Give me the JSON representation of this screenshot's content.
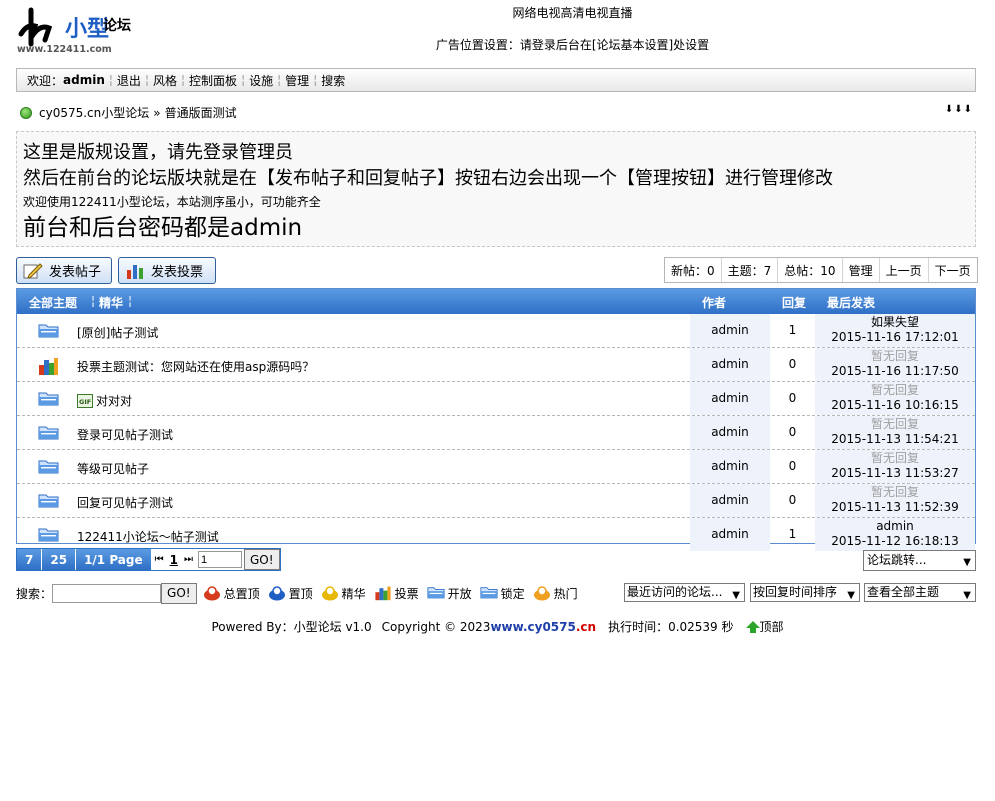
{
  "header": {
    "logo_big": "小型",
    "logo_small": "论坛",
    "logo_url": "www.122411.com",
    "ad_top": "网络电视高清电视直播",
    "ad_main": "广告位置设置：请登录后台在[论坛基本设置]处设置"
  },
  "nav": {
    "welcome": "欢迎：",
    "user": "admin",
    "items": [
      "退出",
      "风格",
      "控制面板",
      "设施",
      "管理",
      "搜索"
    ]
  },
  "breadcrumb": {
    "site": "cy0575.cn小型论坛",
    "separator": "»",
    "board": "普通版面测试",
    "arrows": "⬇⬇⬇"
  },
  "rules": {
    "line1": "这里是版规设置，请先登录管理员",
    "line2": "然后在前台的论坛版块就是在【发布帖子和回复帖子】按钮右边会出现一个【管理按钮】进行管理修改",
    "line3": "欢迎使用122411小型论坛，本站测序虽小，可功能齐全",
    "line4": "前台和后台密码都是admin"
  },
  "buttons": {
    "post": "发表帖子",
    "poll": "发表投票"
  },
  "stats": {
    "new_posts": "新帖：0",
    "topics": "主题：7",
    "total": "总帖：10",
    "manage": "管理",
    "prev": "上一页",
    "next": "下一页"
  },
  "table": {
    "col_all": "全部主题",
    "col_elite": "精华",
    "col_author": "作者",
    "col_replies": "回复",
    "col_last": "最后发表",
    "rows": [
      {
        "icon": "folder-icon",
        "title": "[原创]帖子测试",
        "author": "admin",
        "replies": "1",
        "last_user": "如果失望",
        "last_time": "2015-11-16 17:12:01",
        "gif": false,
        "no_reply": false
      },
      {
        "icon": "poll-icon",
        "title": "投票主题测试：您网站还在使用asp源码吗？",
        "author": "admin",
        "replies": "0",
        "last_user": "暂无回复",
        "last_time": "2015-11-16 11:17:50",
        "gif": false,
        "no_reply": true
      },
      {
        "icon": "folder-icon",
        "title": "对对对",
        "author": "admin",
        "replies": "0",
        "last_user": "暂无回复",
        "last_time": "2015-11-16 10:16:15",
        "gif": true,
        "no_reply": true
      },
      {
        "icon": "folder-icon",
        "title": "登录可见帖子测试",
        "author": "admin",
        "replies": "0",
        "last_user": "暂无回复",
        "last_time": "2015-11-13 11:54:21",
        "gif": false,
        "no_reply": true
      },
      {
        "icon": "folder-icon",
        "title": "等级可见帖子",
        "author": "admin",
        "replies": "0",
        "last_user": "暂无回复",
        "last_time": "2015-11-13 11:53:27",
        "gif": false,
        "no_reply": true
      },
      {
        "icon": "folder-icon",
        "title": "回复可见帖子测试",
        "author": "admin",
        "replies": "0",
        "last_user": "暂无回复",
        "last_time": "2015-11-13 11:52:39",
        "gif": false,
        "no_reply": true
      },
      {
        "icon": "folder-icon",
        "title": "122411小论坛～帖子测试",
        "author": "admin",
        "replies": "1",
        "last_user": "admin",
        "last_time": "2015-11-12 16:18:13",
        "gif": false,
        "no_reply": false
      }
    ]
  },
  "pager": {
    "per_topics": "7",
    "per_page": "25",
    "page_info": "1/1 Page",
    "first": "⏮",
    "current": "1",
    "last": "⏭",
    "input_value": "1",
    "go": "GO!"
  },
  "jump": {
    "label": "论坛跳转..."
  },
  "legend": {
    "search_label": "搜索：",
    "go": "GO!",
    "items": [
      {
        "icon": "global-top-icon",
        "label": "总置顶",
        "color": "#d63a1c"
      },
      {
        "icon": "top-icon",
        "label": "置顶",
        "color": "#1f5fc4"
      },
      {
        "icon": "elite-icon",
        "label": "精华",
        "color": "#e6b800"
      },
      {
        "icon": "poll-icon",
        "label": "投票",
        "color": "#c8261a"
      },
      {
        "icon": "open-icon",
        "label": "开放",
        "color": "#4a8be0"
      },
      {
        "icon": "lock-icon",
        "label": "锁定",
        "color": "#4a8be0"
      },
      {
        "icon": "hot-icon",
        "label": "热门",
        "color": "#f0a020"
      }
    ],
    "sel_recent": "最近访问的论坛...",
    "sel_sort": "按回复时间排序",
    "sel_view": "查看全部主题"
  },
  "footer": {
    "powered": "Powered By：小型论坛 v1.0",
    "copyright": "Copyright © 2023",
    "domain_a": "www.cy0575",
    "domain_b": ".cn",
    "exec": "执行时间：0.02539 秒",
    "top": "顶部"
  }
}
